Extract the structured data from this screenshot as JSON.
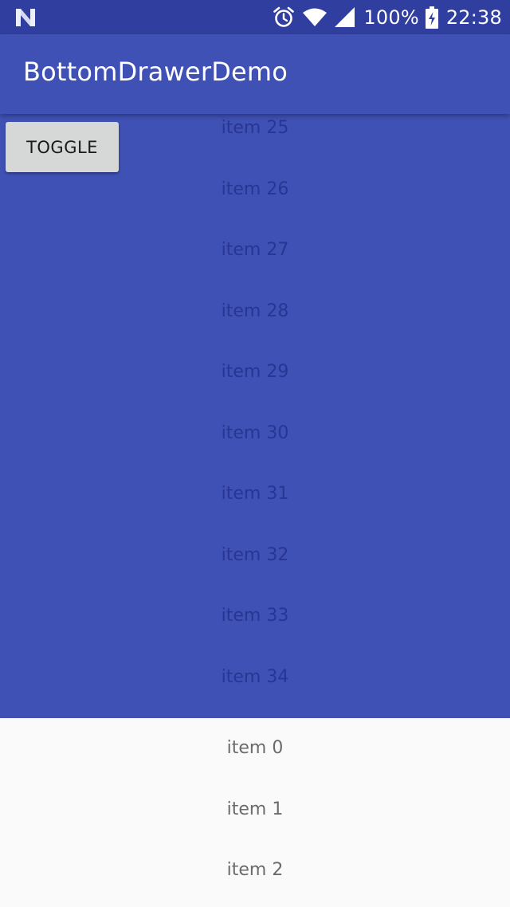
{
  "status_bar": {
    "left_icon": "android-n-notification-icon",
    "icons": [
      "alarm-icon",
      "wifi-icon",
      "cellular-signal-icon",
      "battery-charging-icon"
    ],
    "battery": "100%",
    "time": "22:38"
  },
  "app_bar": {
    "title": "BottomDrawerDemo"
  },
  "toggle_button": {
    "label": "TOGGLE"
  },
  "main_list": {
    "items": [
      "item 25",
      "item 26",
      "item 27",
      "item 28",
      "item 29",
      "item 30",
      "item 31",
      "item 32",
      "item 33",
      "item 34"
    ]
  },
  "drawer_list": {
    "items": [
      "item 0",
      "item 1",
      "item 2"
    ]
  },
  "colors": {
    "primary": "#3f51b5",
    "primary_dark": "#303f9f",
    "drawer_background": "#fafafa",
    "button_background": "#d6d7d7"
  }
}
